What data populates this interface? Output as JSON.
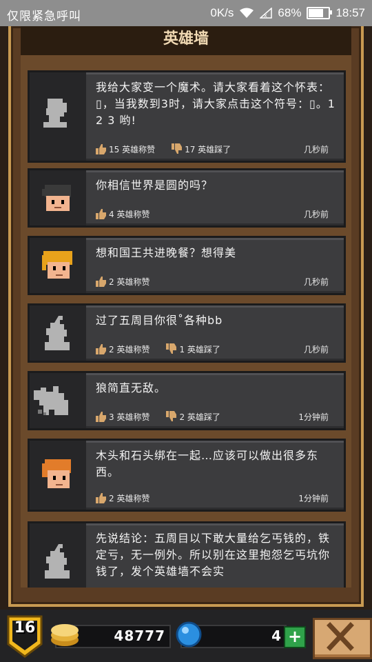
{
  "status_bar": {
    "carrier": "仅限紧急呼叫",
    "speed": "0K/s",
    "battery": "68%",
    "time": "18:57"
  },
  "title": "英雄墙",
  "posts": [
    {
      "text": "我给大家变一个魔术。请大家看着这个怀表：▯，当我数到3时，请大家点击这个符号：▯。1 2 3 哟!",
      "likes": "15 英雄称赞",
      "dislikes": "17 英雄踩了",
      "time": "几秒前",
      "avatar": "silhouette-head-icon"
    },
    {
      "text": "你相信世界是圆的吗？",
      "likes": "4 英雄称赞",
      "time": "几秒前",
      "avatar": "dark-hair-hero-icon"
    },
    {
      "text": "想和国王共进晚餐？想得美",
      "likes": "2 英雄称赞",
      "time": "几秒前",
      "avatar": "blonde-hero-icon"
    },
    {
      "text": "过了五周目你很˚各种bb",
      "likes": "2 英雄称赞",
      "dislikes": "1 英雄踩了",
      "time": "几秒前",
      "avatar": "silhouette-hood-icon"
    },
    {
      "text": "狼简直无敌。",
      "likes": "3 英雄称赞",
      "dislikes": "2 英雄踩了",
      "time": "1分钟前",
      "avatar": "silhouette-wolf-icon"
    },
    {
      "text": "木头和石头绑在一起…应该可以做出很多东西。",
      "likes": "2 英雄称赞",
      "time": "1分钟前",
      "avatar": "orange-hair-hero-icon"
    },
    {
      "text": "先说结论：五周目以下敢大量给乞丐钱的，铁定亏，无一例外。所以别在这里抱怨乞丐坑你钱了，发个英雄墙不会实",
      "avatar": "silhouette-hood-icon"
    }
  ],
  "bottom_bar": {
    "level": "16",
    "gold": "48777",
    "gems": "4",
    "plus_label": "+",
    "close_icon": "close-x-icon"
  },
  "colors": {
    "frame_wood": "#6b4a2b",
    "card_bg": "#3c3c3e",
    "title_text": "#f0d9b3",
    "plus_green": "#2fa24a"
  }
}
